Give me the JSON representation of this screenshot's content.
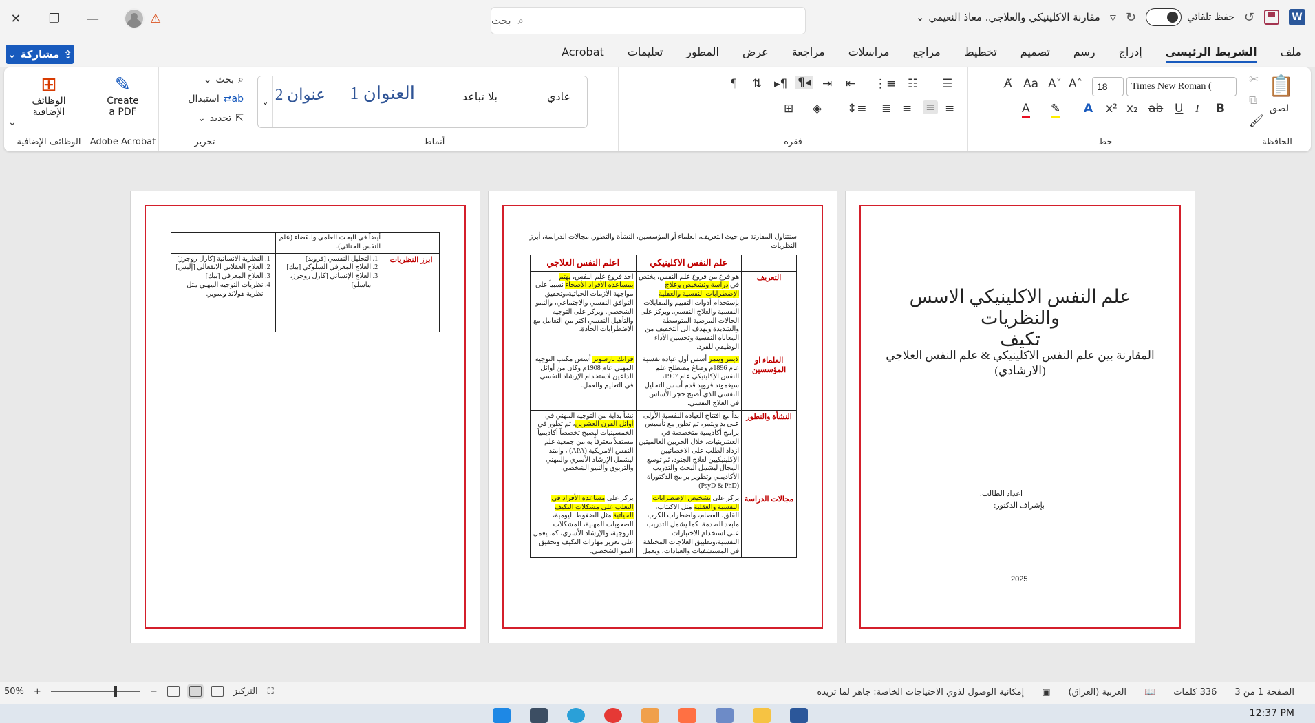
{
  "titlebar": {
    "app_icon": "W",
    "autosave_label": "حفظ تلقائي",
    "doc_title": "مقارنة الاكلينيكي والعلاجي. معاذ النعيمي",
    "search_placeholder": "بحث",
    "icons": [
      "word-icon",
      "save-icon",
      "undo-icon",
      "redo-icon",
      "customize-icon",
      "warning-icon",
      "avatar",
      "minimize-icon",
      "restore-icon",
      "close-icon"
    ]
  },
  "menu": {
    "tabs": [
      "ملف",
      "الشريط الرئيسي",
      "إدراج",
      "رسم",
      "تصميم",
      "تخطيط",
      "مراجع",
      "مراسلات",
      "مراجعة",
      "عرض",
      "المطور",
      "تعليمات",
      "Acrobat"
    ],
    "active_tab": "الشريط الرئيسي",
    "share_label": "مشاركة"
  },
  "ribbon": {
    "clipboard": {
      "label": "الحافظة",
      "paste": "لصق"
    },
    "font": {
      "label": "خط",
      "font_name": "Times New Roman (",
      "font_size": "18",
      "bold": "B",
      "italic": "I",
      "underline": "U",
      "strike": "ab",
      "sub": "x₂",
      "sup": "x²",
      "aa": "Aa"
    },
    "paragraph": {
      "label": "فقرة"
    },
    "styles": {
      "label": "أنماط",
      "items": [
        "عادي",
        "بلا تباعد",
        "العنوان 1",
        "عنوان 2"
      ]
    },
    "editing": {
      "label": "تحرير",
      "find": "بحث",
      "replace": "استبدال",
      "select": "تحديد"
    },
    "acrobat": {
      "label": "Adobe Acrobat",
      "create_line1": "Create",
      "create_line2": "a PDF"
    },
    "addins": {
      "label": "الوظائف الإضافية",
      "button_line1": "الوظائف",
      "button_line2": "الإضافية"
    }
  },
  "page1": {
    "title_line1": "علم النفس الاكلينيكي الاسس والنظريات",
    "title_line2": "تكيف",
    "subtitle_line1": "المقارنة بين علم النفس الاكلينيكي & علم النفس العلاجي",
    "subtitle_line2": "(الارشادي)",
    "student": "اعداد الطالب:",
    "supervisor": "بإشراف الدكتور:",
    "year": "2025"
  },
  "page2": {
    "intro": "سنتناول المقارنة من حيث التعريف، العلماء أو المؤسسين، النشأة والتطور، مجالات الدراسة، أبرز النظريات",
    "headers": [
      "",
      "علم النفس الاكلينيكي",
      "اعلم النفس العلاجي"
    ],
    "rows": [
      {
        "head": "التعريف",
        "c1_pre": "هو فرع من فروع علم النفس، يختص في ",
        "c1_hl": "دراسة وتشخيص وعلاج الإضطرابات النفسية والعقلية",
        "c1_post": " بإستخدام أدوات التقييم والمقابلات النفسية والعلاج النفسي. ويركز على الحالات المرضية المتوسطة والشديدة ويهدف الى التخفيف من المعاناه النفسية وتحسين الأداء الوظيفي للفرد.",
        "c2_pre": "احد فروع علم النفس، ",
        "c2_hl": "يهتم بمساعده الأفراد الأصحاء",
        "c2_post": " نسبياً على مواجهة الأزمات الحياتية،وتحقيق التوافق النفسي والاجتماعي، والنمو الشخصي. ويركز على التوجيه والتأهيل النفسي اكثر من التعامل مع الاضطرابات الحادة."
      },
      {
        "head": "العلماء او المؤسسين",
        "c1_pre": "",
        "c1_hl": "لايتنر ويتمر",
        "c1_post": " أسس أول عياده نفسية عام 1896م وصاغ مصطلح علم النفس الإكلينيكي عام 1907، سيغموند فرويد قدم أسس التحليل النفسي الذي أصبح حجر الأساس في العلاج النفسي.",
        "c2_pre": "",
        "c2_hl": "فرانك بارسونز",
        "c2_post": " أسس مكتب التوجيه المهني عام 1908م وكان من أوائل الداعين لاستخدام الإرشاد النفسي في التعليم والعمل."
      },
      {
        "head": "النشأة والتطور",
        "c1_pre": "بدأ مع افتتاح العياده النفسية الأولى على يد ويتمر، ثم تطور مع تأسيس برامج أكاديمية متخصصة في العشرينيات. خلال الحربين العالميتين ازداد الطلب على الاخصائيين الإكلينيكيين لعلاج الجنود، ثم توسع المجال ليشمل البحث والتدريب الأكاديمي وتطوير برامج الدكتوراة (PsyD & PhD)",
        "c1_hl": "",
        "c1_post": "",
        "c2_pre": "نشأ بداية من التوجيه المهني في ",
        "c2_hl": "أوائل القرن العشرين",
        "c2_post": "، ثم تطور في الخمسينيات ليصبح تخصصاً أكاديمياً مستقلاً معترفاً به من جمعية علم النفس الامريكية (APA) ، وامتد ليشمل الإرشاد الأسري والمهني والتربوي والنمو الشخصي."
      },
      {
        "head": "مجالات الدراسة",
        "c1_pre": "يركز على ",
        "c1_hl": "تشخيص الإضطرابات النفسية والعقلية",
        "c1_post": " مثل الاكتئاب، القلق، الفصام، واضطراب الكرب مابعد الصدمة. كما يشمل التدريب على استخدام الاختبارات النفسية،وتطبيق العلاجات المختلفة في المستشفيات والعيادات، ويعمل",
        "c2_pre": "يركز على ",
        "c2_hl": "مساعده الأفراد في التغلب على مشكلات التكيف الحياتية",
        "c2_post": " مثل الضغوط اليومية، الصعوبات المهنية، المشكلات الزوجية، والإرشاد الأسري، كما يعمل على تعزيز مهارات التكيف وتحقيق النمو الشخصي."
      }
    ]
  },
  "page3": {
    "top_c1": "",
    "top_c2": "أيضاً في البحث العلمي والقضاء (علم النفس الجنائي).",
    "top_c3": "",
    "row_head": "ابرز النظريات",
    "c1_items": [
      "التحليل النفسي [فرويد]",
      "العلاج المعرفي السلوكي [بيك]",
      "العلاج الإنساني [كارل روجرز، ماسلو]"
    ],
    "c2_items": [
      "النظرية الانسانية [كارل روجرز]",
      "العلاج العقلاني الانفعالي [إليس]",
      "العلاج المعرفي [بيك]",
      "نظريات التوجيه المهني مثل نظرية هولاند وسوبر."
    ]
  },
  "status": {
    "page": "الصفحة 1 من 3",
    "words": "336 كلمات",
    "language": "العربية (العراق)",
    "accessibility": "إمكانية الوصول لذوي الاحتياجات الخاصة: جاهز لما تريده",
    "focus": "التركيز",
    "zoom": "50%"
  },
  "taskbar": {
    "time": "12:37 PM"
  },
  "colors": {
    "accent": "#185abd",
    "frame_red": "#d41f2b",
    "highlight": "#ffff00",
    "header_red": "#c00000"
  }
}
